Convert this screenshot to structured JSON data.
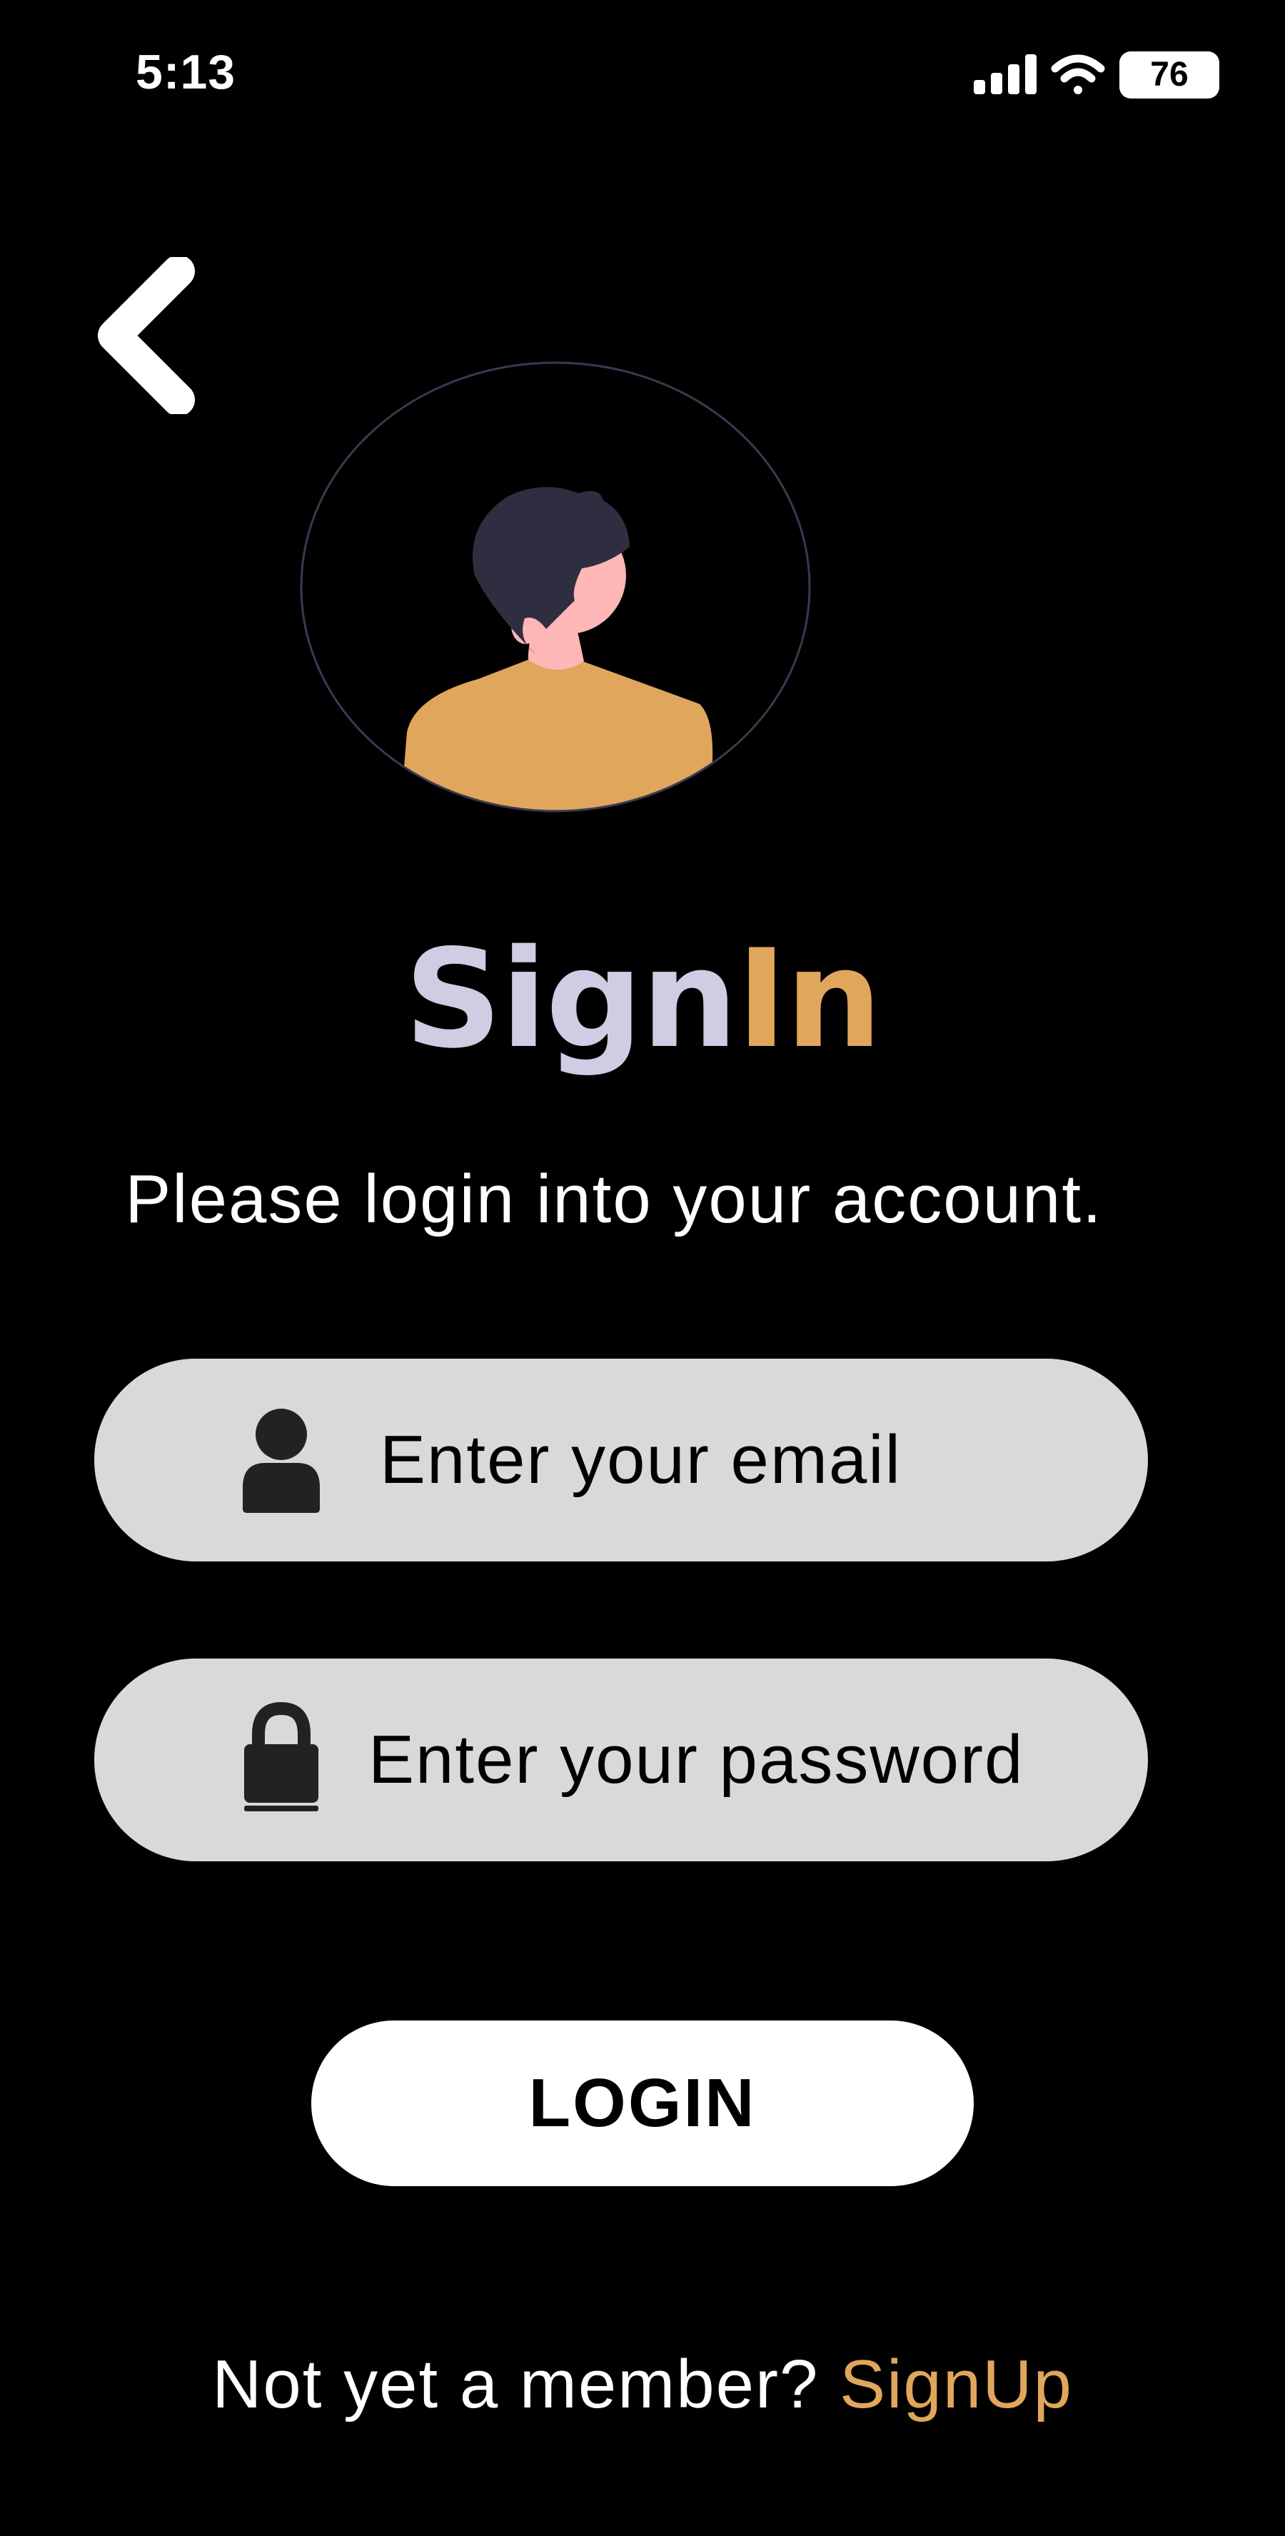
{
  "status_bar": {
    "time": "5:13",
    "battery": "76",
    "icons": [
      "cellular-signal-icon",
      "wifi-icon",
      "battery-icon"
    ]
  },
  "header": {
    "back_icon": "chevron-left-icon"
  },
  "avatar": {
    "icon": "person-avatar-illustration",
    "colors": {
      "hair": "#2f2e41",
      "skin": "#ffb6b6",
      "shirt": "#e0a65c"
    }
  },
  "title": {
    "part1": "Sign",
    "part2": "In"
  },
  "subtitle": "Please login into your account.",
  "form": {
    "email": {
      "placeholder": "Enter your email",
      "value": "",
      "icon": "user-icon"
    },
    "password": {
      "placeholder": "Enter your password",
      "value": "",
      "icon": "lock-icon"
    },
    "login_label": "LOGIN"
  },
  "footer": {
    "prompt": "Not yet a member? ",
    "signup_label": "SignUp"
  },
  "colors": {
    "background": "#000000",
    "accent": "#e0a65c",
    "title_primary": "#cfcde3",
    "field_bg": "#d9d9d9",
    "button_bg": "#ffffff"
  }
}
